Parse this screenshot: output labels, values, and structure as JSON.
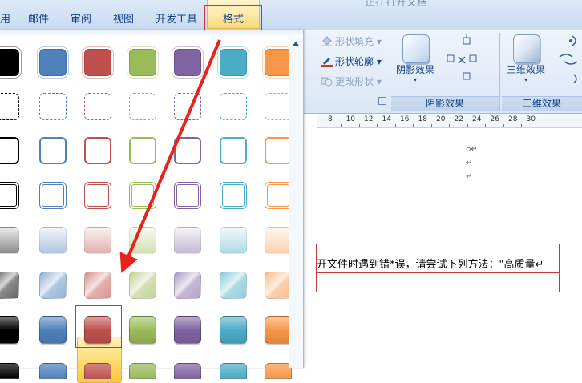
{
  "tabs": {
    "partial_left": "用",
    "items": [
      "邮件",
      "审阅",
      "视图",
      "开发工具"
    ],
    "active": "格式"
  },
  "title_fragment": "正在打开文档",
  "ribbon": {
    "shape_styles_group": {
      "commands": [
        {
          "label": "形状填充",
          "enabled": false
        },
        {
          "label": "形状轮廓",
          "enabled": true
        },
        {
          "label": "更改形状",
          "enabled": false
        }
      ]
    },
    "shadow_group": {
      "button_label": "阴影效果",
      "group_label": "阴影效果"
    },
    "threed_group": {
      "button_label": "三维效果",
      "group_label": "三维效果"
    }
  },
  "ruler": [
    "8",
    "10",
    "12",
    "14",
    "16",
    "18",
    "20",
    "22",
    "24",
    "26",
    "28",
    "30"
  ],
  "document": {
    "marks": [
      "b↵",
      "↵",
      "↵"
    ],
    "textbox_line": "开文件时遇到错*误，请尝试下列方法：\"高质量↵"
  },
  "gallery": {
    "colors": {
      "black": "#000000",
      "blue": "#4f81bd",
      "red": "#c0504d",
      "green": "#9bbb59",
      "purple": "#8064a2",
      "aqua": "#4bacc6",
      "orange": "#f79646"
    },
    "rows": [
      "filled-plain",
      "dashed-outline",
      "outline",
      "double-outline",
      "light-gradient",
      "glossy-light",
      "glossy-intense",
      "partial-intense"
    ],
    "selected": {
      "row": 7,
      "col": 2,
      "color": "red"
    }
  },
  "annotations": {
    "arrow_color": "#e8231c",
    "box_color": "#d9302b"
  }
}
